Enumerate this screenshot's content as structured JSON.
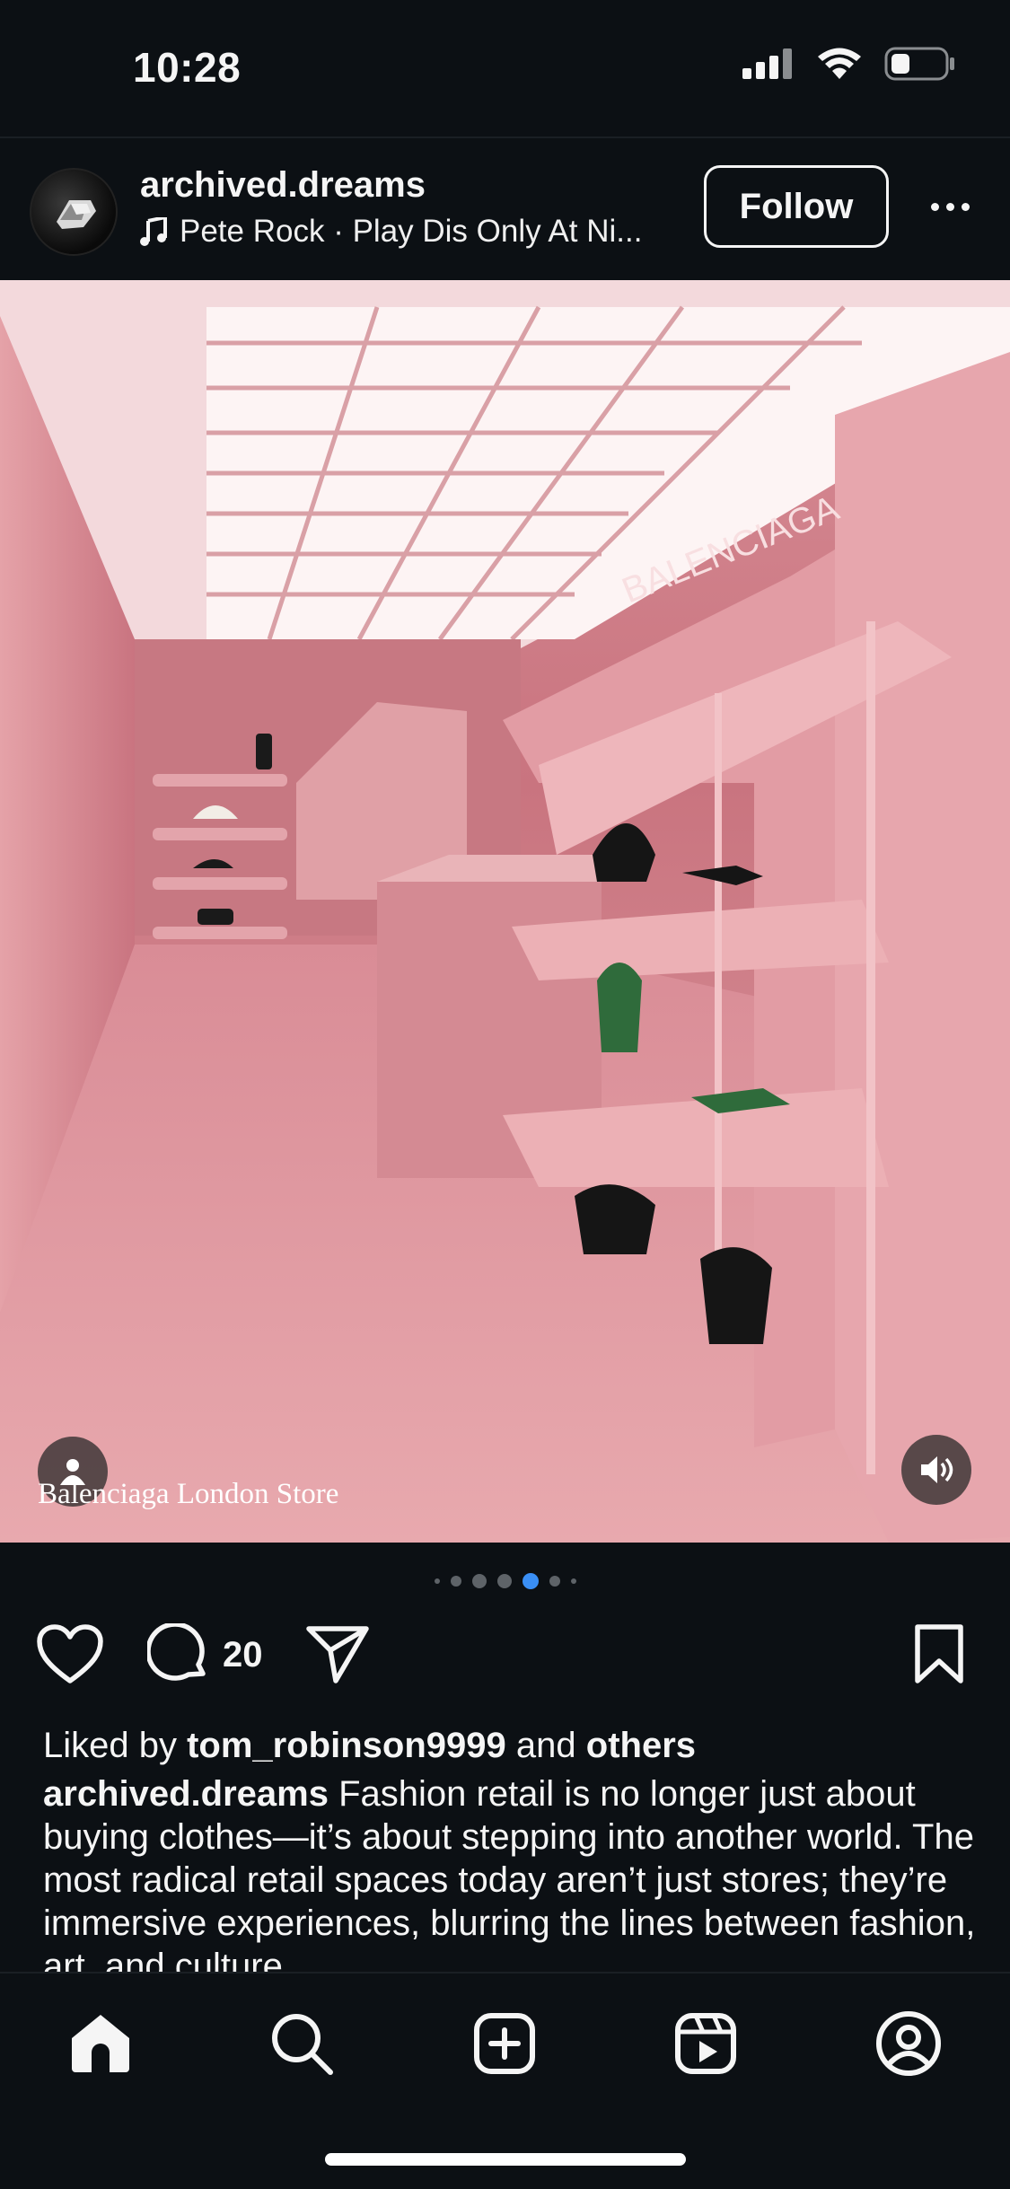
{
  "status_bar": {
    "time": "10:28",
    "icons": [
      "signal-icon",
      "wifi-icon",
      "battery-icon"
    ]
  },
  "post": {
    "username": "archived.dreams",
    "music": "Pete Rock · Play Dis Only At Ni...",
    "follow_label": "Follow",
    "image_caption_overlay": "Balenciaga London Store",
    "carousel": {
      "total": 7,
      "active_index": 4
    },
    "comment_count": "20",
    "liked_by_prefix": "Liked by",
    "liked_by_user": "tom_robinson9999",
    "liked_by_and": "and",
    "liked_by_others": "others",
    "caption_user": "archived.dreams",
    "caption_text": "Fashion retail is no longer just about buying clothes—it’s about stepping into another world. The most radical retail spaces today aren’t just stores; they’re immersive experiences, blurring the lines between fashion, art, and culture."
  },
  "tab_bar": [
    "home-icon",
    "search-icon",
    "create-icon",
    "reels-icon",
    "profile-icon"
  ],
  "colors": {
    "background": "#0c1014",
    "active_dot": "#3a8ff5",
    "text": "#f5f5f5"
  }
}
